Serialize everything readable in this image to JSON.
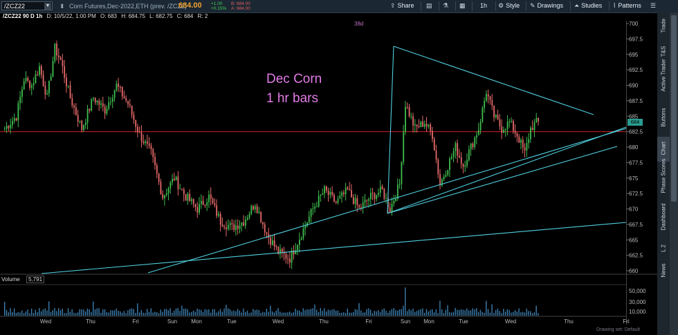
{
  "toolbar": {
    "symbol": "/ZCZ22",
    "description": "Corn Futures,Dec-2022,ETH (prev. /ZCZ2)",
    "last_price": "684.00",
    "net_change": "+1.00",
    "pct_change": "+0.15%",
    "bid": "B: 684.00",
    "ask": "A: 684.00",
    "share_label": "Share",
    "timeframe_label": "1h",
    "style_label": "Style",
    "drawings_label": "Drawings",
    "studies_label": "Studies",
    "patterns_label": "Patterns"
  },
  "infobar": {
    "chart_name": "/ZCZ22 90 D 1h",
    "date": "D: 10/5/22, 1:00 PM",
    "open": "O: 683",
    "high": "H: 684.75",
    "low": "L: 682.75",
    "close": "C: 684",
    "range": "R: 2"
  },
  "annotations": {
    "line1": "Dec Corn",
    "line2": "1 hr bars",
    "top_partial": "38d"
  },
  "price_tag": "684",
  "side_tabs": [
    "Trade",
    "T&S",
    "Active Trader",
    "Buttons",
    "Chart",
    "Phase Scores",
    "Dashboard",
    "L 2",
    "News"
  ],
  "volume": {
    "label": "Volume",
    "value": "5,791"
  },
  "drawing_set": "Drawing set: Default",
  "colors": {
    "up": "#3fbf4f",
    "down": "#e86a6a",
    "trendline": "#4fd0e0",
    "price_line": "#d02020",
    "annotation": "#e27ce6"
  },
  "chart_data": {
    "type": "candlestick",
    "price_axis": {
      "min": 660,
      "max": 700,
      "ticks": [
        700,
        697.5,
        695,
        692.5,
        690,
        687.5,
        685,
        682.5,
        680,
        677.5,
        675,
        672.5,
        670,
        667.5,
        665,
        662.5,
        660
      ]
    },
    "volume_axis": {
      "ticks": [
        "50,000",
        "30,000",
        "10,000"
      ]
    },
    "x_labels": [
      "Wed",
      "Thu",
      "Fri",
      "Sun",
      "Mon",
      "Tue",
      "Wed",
      "Thu",
      "Fri",
      "Sun",
      "Mon",
      "Tue",
      "Wed",
      "Thu",
      "Fri"
    ],
    "horizontal_line": 682.5,
    "closes_anchor": [
      [
        0,
        683
      ],
      [
        6,
        685
      ],
      [
        10,
        691
      ],
      [
        14,
        690
      ],
      [
        18,
        693
      ],
      [
        22,
        688
      ],
      [
        26,
        696
      ],
      [
        29,
        694
      ],
      [
        34,
        688
      ],
      [
        40,
        683
      ],
      [
        46,
        688
      ],
      [
        52,
        686
      ],
      [
        58,
        690
      ],
      [
        64,
        687
      ],
      [
        70,
        682
      ],
      [
        76,
        679
      ],
      [
        82,
        672
      ],
      [
        88,
        675
      ],
      [
        94,
        672
      ],
      [
        100,
        670
      ],
      [
        106,
        672
      ],
      [
        112,
        668
      ],
      [
        118,
        667
      ],
      [
        124,
        668
      ],
      [
        130,
        671
      ],
      [
        136,
        666
      ],
      [
        142,
        663
      ],
      [
        148,
        662
      ],
      [
        154,
        666
      ],
      [
        160,
        670
      ],
      [
        166,
        673
      ],
      [
        172,
        671
      ],
      [
        178,
        673
      ],
      [
        184,
        670
      ],
      [
        190,
        672
      ],
      [
        196,
        673
      ],
      [
        200,
        670
      ],
      [
        205,
        674
      ],
      [
        208,
        687
      ],
      [
        213,
        683
      ],
      [
        218,
        684
      ],
      [
        222,
        682
      ],
      [
        226,
        674
      ],
      [
        230,
        677
      ],
      [
        234,
        680
      ],
      [
        238,
        677
      ],
      [
        242,
        680
      ],
      [
        246,
        683
      ],
      [
        250,
        689
      ],
      [
        254,
        685
      ],
      [
        258,
        683
      ],
      [
        262,
        684
      ],
      [
        266,
        682
      ],
      [
        270,
        679
      ],
      [
        273,
        683
      ],
      [
        276,
        684
      ]
    ]
  }
}
